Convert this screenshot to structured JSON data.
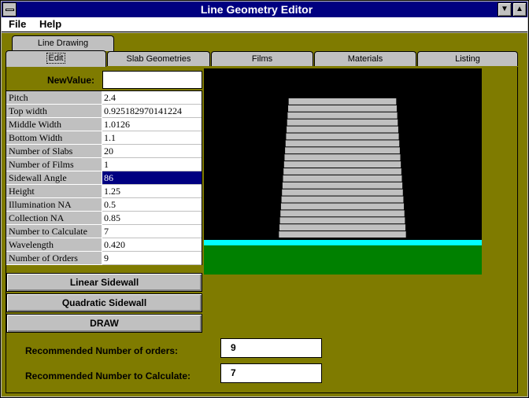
{
  "window": {
    "title": "Line Geometry Editor",
    "minimize_glyph": "▼",
    "maximize_glyph": "▲"
  },
  "menu": [
    "File",
    "Help"
  ],
  "outer_tab": "Line Drawing",
  "tabs": [
    "Edit",
    "Slab Geometries",
    "Films",
    "Materials",
    "Listing"
  ],
  "active_tab": "Edit",
  "new_value": {
    "label": "NewValue:",
    "value": ""
  },
  "properties": [
    {
      "name": "Pitch",
      "value": "2.4"
    },
    {
      "name": "Top width",
      "value": "0.925182970141224"
    },
    {
      "name": "Middle Width",
      "value": "1.0126"
    },
    {
      "name": "Bottom Width",
      "value": "1.1"
    },
    {
      "name": "Number of Slabs",
      "value": " 20"
    },
    {
      "name": "Number of Films",
      "value": "  1"
    },
    {
      "name": "Sidewall Angle",
      "value": "86",
      "selected": true
    },
    {
      "name": "Height",
      "value": "1.25"
    },
    {
      "name": "Illumination NA",
      "value": "0.5"
    },
    {
      "name": "Collection NA",
      "value": "0.85"
    },
    {
      "name": "Number to Calculate",
      "value": "  7"
    },
    {
      "name": "Wavelength",
      "value": "0.420"
    },
    {
      "name": "Number of Orders",
      "value": "  9"
    }
  ],
  "buttons": {
    "linear": "Linear Sidewall",
    "quadratic": "Quadratic Sidewall",
    "draw": "DRAW"
  },
  "drawing": {
    "slab_count": 20,
    "slab_color": "#c0c0c0",
    "film_color": "#00ffff",
    "substrate_color": "#008000",
    "background_color": "#000000"
  },
  "recommended": {
    "orders_label": "Recommended Number of orders:",
    "orders_value": "9",
    "calc_label": "Recommended Number to Calculate:",
    "calc_value": "7"
  },
  "colors": {
    "client_bg": "#7f7b00",
    "title_bg": "#000080",
    "selection": "#000080"
  }
}
